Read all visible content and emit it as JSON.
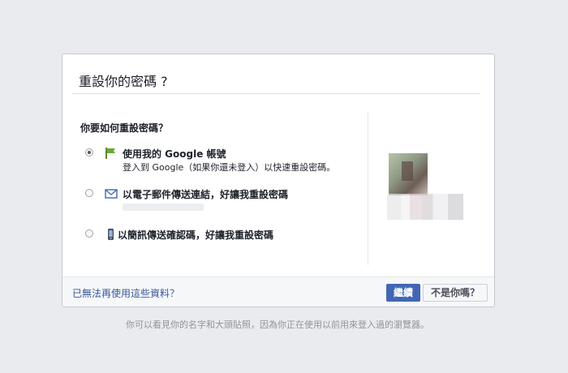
{
  "dialog": {
    "title": "重設你的密碼 ?",
    "question": "你要如何重設密碼？",
    "options": [
      {
        "label": "使用我的 Google 帳號",
        "sublabel": "登入到 Google（如果你還未登入）以快速重設密碼。",
        "icon": "green-flag-icon",
        "selected": true
      },
      {
        "label": "以電子郵件傳送連結，好讓我重設密碼",
        "icon": "envelope-icon",
        "selected": false
      },
      {
        "label": "以簡訊傳送確認碼，好讓我重設密碼",
        "icon": "phone-icon",
        "selected": false
      }
    ],
    "footer": {
      "link": "已無法再使用這些資料？",
      "continue_button": "繼續",
      "not_you_button": "不是你嗎？"
    }
  },
  "note": "你可以看見你的名字和大頭貼照，因為你正在使用以前用來登入過的瀏覽器。",
  "colors": {
    "background": "#e9ebee",
    "primary_button": "#4267b2",
    "link": "#385898"
  }
}
